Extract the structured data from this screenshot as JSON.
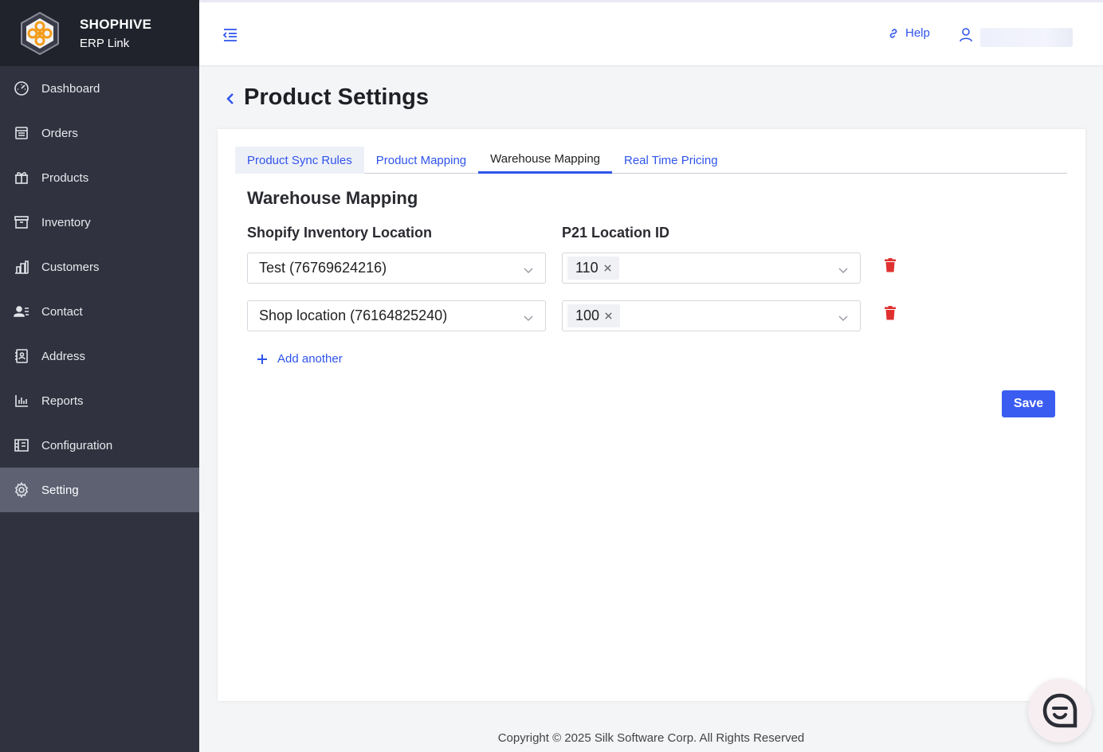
{
  "brand": {
    "name": "SHOPHIVE",
    "subtitle": "ERP Link"
  },
  "sidebar": {
    "items": [
      {
        "label": "Dashboard",
        "icon": "dashboard-icon",
        "active": false
      },
      {
        "label": "Orders",
        "icon": "orders-icon",
        "active": false
      },
      {
        "label": "Products",
        "icon": "products-icon",
        "active": false
      },
      {
        "label": "Inventory",
        "icon": "inventory-icon",
        "active": false
      },
      {
        "label": "Customers",
        "icon": "customers-icon",
        "active": false
      },
      {
        "label": "Contact",
        "icon": "contact-icon",
        "active": false
      },
      {
        "label": "Address",
        "icon": "address-icon",
        "active": false
      },
      {
        "label": "Reports",
        "icon": "reports-icon",
        "active": false
      },
      {
        "label": "Configuration",
        "icon": "configuration-icon",
        "active": false
      },
      {
        "label": "Setting",
        "icon": "gear-icon",
        "active": true
      }
    ]
  },
  "header": {
    "help_label": "Help"
  },
  "page": {
    "title": "Product Settings"
  },
  "tabs": [
    {
      "label": "Product Sync Rules",
      "active": false
    },
    {
      "label": "Product Mapping",
      "active": false
    },
    {
      "label": "Warehouse Mapping",
      "active": true
    },
    {
      "label": "Real Time Pricing",
      "active": false
    }
  ],
  "warehouse": {
    "section_title": "Warehouse Mapping",
    "col_shopify": "Shopify Inventory Location",
    "col_p21": "P21 Location ID",
    "rows": [
      {
        "shopify_location": "Test (76769624216)",
        "p21_tag": "110"
      },
      {
        "shopify_location": "Shop location (76164825240)",
        "p21_tag": "100"
      }
    ],
    "add_label": "Add another",
    "save_label": "Save"
  },
  "footer": {
    "copyright": "Copyright © 2025 Silk Software Corp. All Rights Reserved"
  },
  "colors": {
    "accent": "#2f54eb",
    "sidebar_bg": "#30333f",
    "brand_bg": "#21232c",
    "active_nav": "#5d6172",
    "danger": "#e03131",
    "save": "#3b5cf0"
  }
}
